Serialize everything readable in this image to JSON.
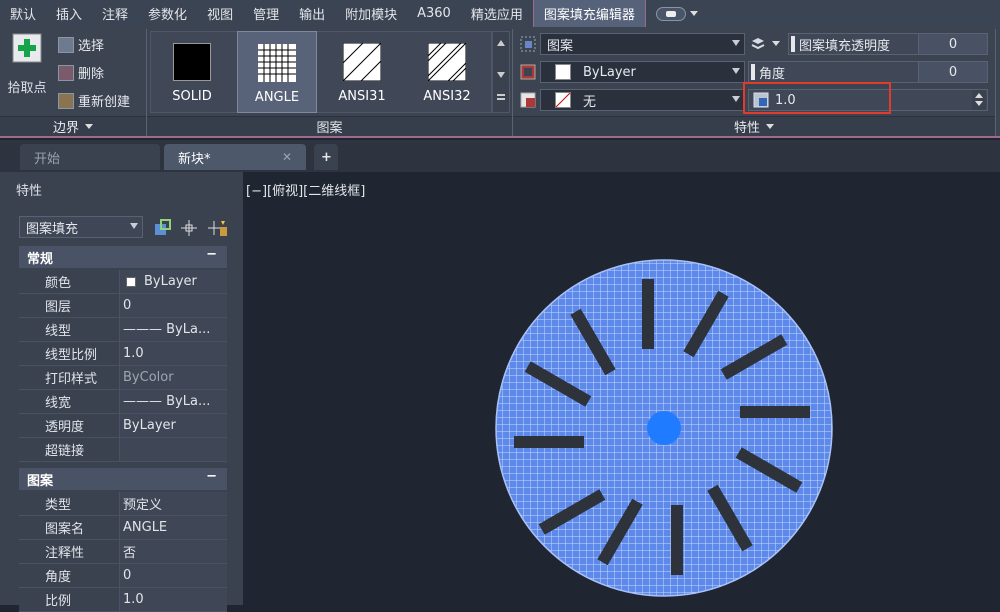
{
  "ribbon_tabs": [
    {
      "label": "默认"
    },
    {
      "label": "插入"
    },
    {
      "label": "注释"
    },
    {
      "label": "参数化"
    },
    {
      "label": "视图"
    },
    {
      "label": "管理"
    },
    {
      "label": "输出"
    },
    {
      "label": "附加模块"
    },
    {
      "label": "A360"
    },
    {
      "label": "精选应用"
    },
    {
      "label": "图案填充编辑器"
    }
  ],
  "ribbon": {
    "pick_point": "拾取点",
    "select": "选择",
    "remove": "删除",
    "recreate": "重新创建",
    "boundary_panel": "边界",
    "pattern_panel": "图案",
    "properties_panel": "特性",
    "patterns": [
      {
        "label": "SOLID"
      },
      {
        "label": "ANGLE"
      },
      {
        "label": "ANSI31"
      },
      {
        "label": "ANSI32"
      }
    ],
    "type_value": "图案",
    "color_value": "ByLayer",
    "bg_value": "无",
    "transparency_label": "图案填充透明度",
    "transparency_value": "0",
    "angle_label": "角度",
    "angle_value": "0",
    "scale_value": "1.0",
    "highlight_color": "#e23b2e"
  },
  "doc_tabs": {
    "start": "开始",
    "current": "新块*"
  },
  "properties": {
    "title": "特性",
    "selector": "图案填充",
    "general_header": "常规",
    "general": [
      {
        "k": "颜色",
        "v": "ByLayer"
      },
      {
        "k": "图层",
        "v": "0"
      },
      {
        "k": "线型",
        "v": "——— ByLa..."
      },
      {
        "k": "线型比例",
        "v": "1.0"
      },
      {
        "k": "打印样式",
        "v": "ByColor"
      },
      {
        "k": "线宽",
        "v": "——— ByLa..."
      },
      {
        "k": "透明度",
        "v": "ByLayer"
      },
      {
        "k": "超链接",
        "v": ""
      }
    ],
    "pattern_header": "图案",
    "pattern": [
      {
        "k": "类型",
        "v": "预定义"
      },
      {
        "k": "图案名",
        "v": "ANGLE"
      },
      {
        "k": "注释性",
        "v": "否"
      },
      {
        "k": "角度",
        "v": "0"
      },
      {
        "k": "比例",
        "v": "1.0"
      }
    ]
  },
  "canvas": {
    "view_label": "[−][俯视][二维线框]",
    "fill_color": "#5d8aea",
    "slot_color": "#2e333b",
    "center_color": "#1f7bff"
  }
}
